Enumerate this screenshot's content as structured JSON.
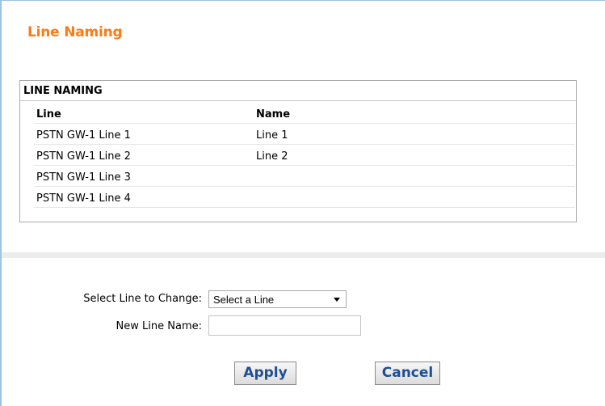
{
  "page": {
    "title": "Line Naming"
  },
  "table": {
    "heading": "LINE NAMING",
    "columns": {
      "line": "Line",
      "name": "Name"
    },
    "rows": [
      {
        "line": "PSTN GW-1 Line 1",
        "name": "Line 1"
      },
      {
        "line": "PSTN GW-1 Line 2",
        "name": "Line 2"
      },
      {
        "line": "PSTN GW-1 Line 3",
        "name": ""
      },
      {
        "line": "PSTN GW-1 Line 4",
        "name": ""
      }
    ]
  },
  "form": {
    "select_label": "Select Line to Change:",
    "select_value": "Select a Line",
    "name_label": "New Line Name:",
    "name_value": ""
  },
  "buttons": {
    "apply": "Apply",
    "cancel": "Cancel"
  },
  "colors": {
    "title": "#ff7a11",
    "button_text": "#1f4e91",
    "frame_border": "#9cc3e0"
  },
  "icons": {
    "dropdown": "chevron-down-icon"
  }
}
